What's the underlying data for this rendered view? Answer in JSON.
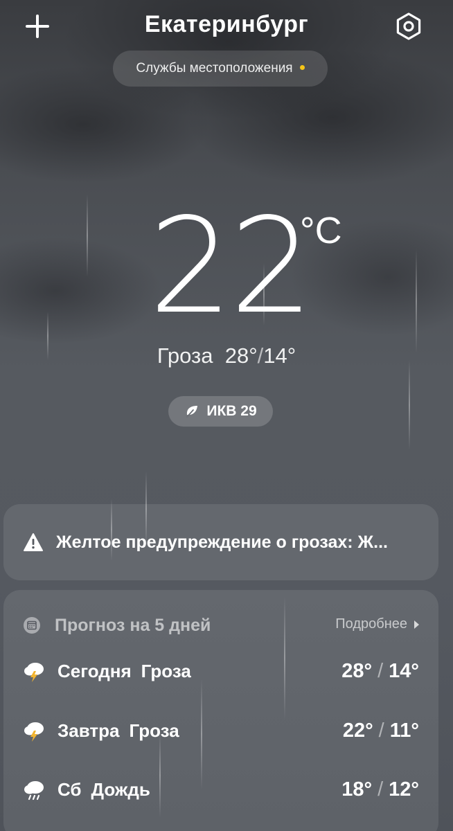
{
  "header": {
    "city": "Екатеринбург",
    "location_services": "Службы местоположения"
  },
  "current": {
    "temperature": "22",
    "unit": "°C",
    "condition": "Гроза",
    "high": "28°",
    "low": "14°",
    "aqi_label": "ИКВ 29"
  },
  "alert": {
    "text": "Желтое предупреждение о грозах: Ж..."
  },
  "forecast": {
    "title": "Прогноз на 5 дней",
    "more_label": "Подробнее",
    "days": [
      {
        "day": "Сегодня",
        "condition": "Гроза",
        "high": "28°",
        "low": "14°",
        "icon": "thunderstorm-icon"
      },
      {
        "day": "Завтра",
        "condition": "Гроза",
        "high": "22°",
        "low": "11°",
        "icon": "thunderstorm-icon"
      },
      {
        "day": "Сб",
        "condition": "Дождь",
        "high": "18°",
        "low": "12°",
        "icon": "rain-icon"
      }
    ]
  },
  "colors": {
    "accent_dot": "#f5c518",
    "lightning": "#f2b531"
  }
}
